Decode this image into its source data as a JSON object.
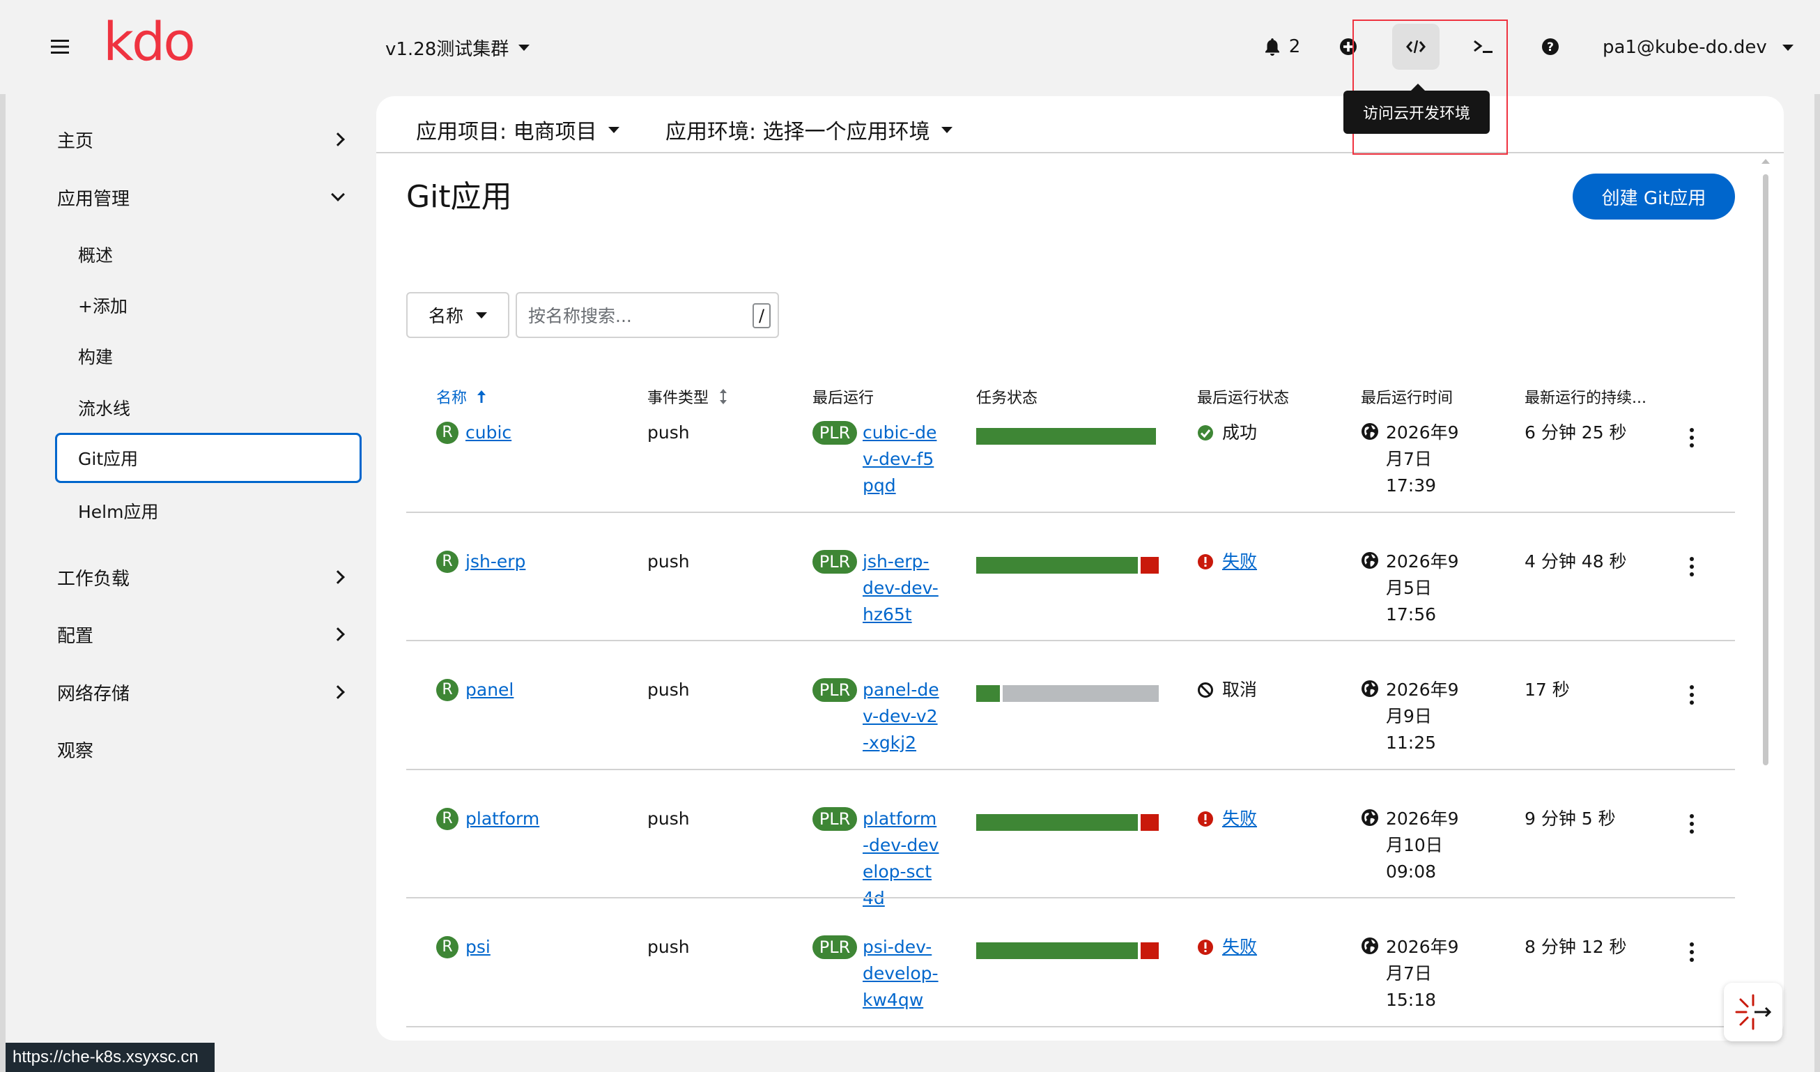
{
  "topbar": {
    "logo_text": "kdo",
    "cluster_label": "v1.28测试集群",
    "notification_count": "2",
    "user_email": "pa1@kube-do.dev",
    "tooltip": "访问云开发环境",
    "brand_color": "#ef3340"
  },
  "sidebar": {
    "groups": {
      "home": "主页",
      "app_mgmt": "应用管理",
      "workloads": "工作负载",
      "config": "配置",
      "network_storage": "网络存储",
      "observe": "观察"
    },
    "sub_items": {
      "overview": "概述",
      "add": "+添加",
      "builds": "构建",
      "pipelines": "流水线",
      "git_apps": "Git应用",
      "helm_apps": "Helm应用"
    }
  },
  "context": {
    "project": "应用项目: 电商项目",
    "environment": "应用环境: 选择一个应用环境"
  },
  "page": {
    "title": "Git应用",
    "create_button": "创建 Git应用"
  },
  "filter": {
    "select_label": "名称",
    "search_placeholder": "按名称搜索...",
    "shortcut_key": "/"
  },
  "table": {
    "columns": {
      "name": "名称",
      "event_type": "事件类型",
      "last_run": "最后运行",
      "task_status": "任务状态",
      "last_run_status": "最后运行状态",
      "last_run_time": "最后运行时间",
      "duration": "最新运行的持续..."
    },
    "rows": [
      {
        "badge": "R",
        "name": "cubic",
        "event": "push",
        "plr_badge": "PLR",
        "plr_name": "cubic-dev-dev-f5pqd",
        "task_progress": {
          "success": 1.0,
          "failed": 0.0,
          "cancelled": 0.0
        },
        "status": "成功",
        "status_kind": "success",
        "time": "2026年9月7日 17:39",
        "duration": "6 分钟 25 秒"
      },
      {
        "badge": "R",
        "name": "jsh-erp",
        "event": "push",
        "plr_badge": "PLR",
        "plr_name": "jsh-erp-dev-dev-hz65t",
        "task_progress": {
          "success": 0.9,
          "failed": 0.1,
          "cancelled": 0.0
        },
        "status": "失败",
        "status_kind": "failed",
        "time": "2026年9月5日 17:56",
        "duration": "4 分钟 48 秒"
      },
      {
        "badge": "R",
        "name": "panel",
        "event": "push",
        "plr_badge": "PLR",
        "plr_name": "panel-dev-dev-v2-xgkj2",
        "task_progress": {
          "success": 0.13,
          "failed": 0.0,
          "cancelled": 0.87
        },
        "status": "取消",
        "status_kind": "cancelled",
        "time": "2026年9月9日 11:25",
        "duration": "17 秒"
      },
      {
        "badge": "R",
        "name": "platform",
        "event": "push",
        "plr_badge": "PLR",
        "plr_name": "platform-dev-develop-sct4d",
        "task_progress": {
          "success": 0.9,
          "failed": 0.1,
          "cancelled": 0.0
        },
        "status": "失败",
        "status_kind": "failed",
        "time": "2026年9月10日 09:08",
        "duration": "9 分钟 5 秒"
      },
      {
        "badge": "R",
        "name": "psi",
        "event": "push",
        "plr_badge": "PLR",
        "plr_name": "psi-dev-develop-kw4qw",
        "task_progress": {
          "success": 0.9,
          "failed": 0.1,
          "cancelled": 0.0
        },
        "status": "失败",
        "status_kind": "failed",
        "time": "2026年9月7日 15:18",
        "duration": "8 分钟 12 秒"
      }
    ]
  },
  "statusbar": {
    "url": "https://che-k8s.xsyxsc.cn"
  },
  "colors": {
    "primary": "#0066cc",
    "success": "#3e8635",
    "danger": "#c9190b",
    "neutral_bar": "#b8bbbe"
  }
}
